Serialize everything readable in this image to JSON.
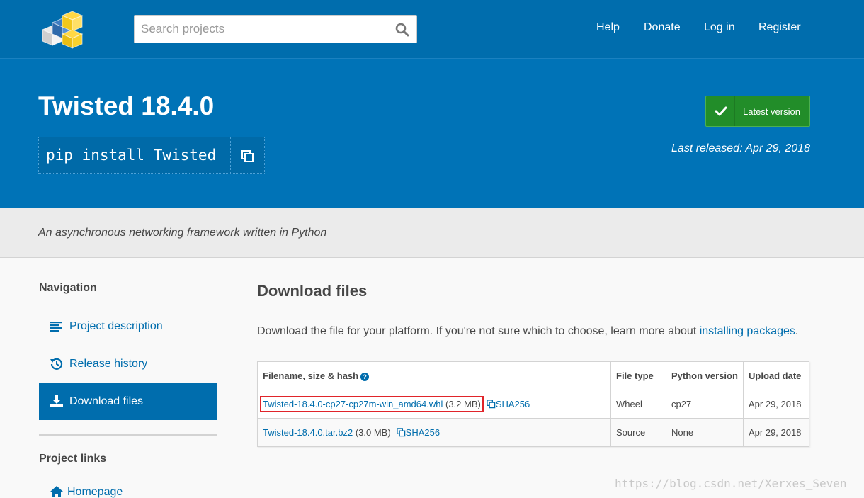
{
  "header": {
    "search_placeholder": "Search projects",
    "nav": [
      "Help",
      "Donate",
      "Log in",
      "Register"
    ]
  },
  "banner": {
    "title": "Twisted 18.4.0",
    "pip_command": "pip install Twisted",
    "latest_label": "Latest version",
    "released": "Last released: Apr 29, 2018"
  },
  "summary": "An asynchronous networking framework written in Python",
  "sidebar": {
    "navigation_heading": "Navigation",
    "items": [
      {
        "label": "Project description",
        "icon": "align-left-icon"
      },
      {
        "label": "Release history",
        "icon": "history-icon"
      },
      {
        "label": "Download files",
        "icon": "download-icon",
        "active": true
      }
    ],
    "links_heading": "Project links",
    "links": [
      {
        "label": "Homepage",
        "icon": "home-icon"
      }
    ]
  },
  "main": {
    "heading": "Download files",
    "intro_text": "Download the file for your platform. If you're not sure which to choose, learn more about ",
    "intro_link": "installing packages",
    "intro_end": ".",
    "table": {
      "headers": [
        "Filename, size & hash",
        "File type",
        "Python version",
        "Upload date"
      ],
      "rows": [
        {
          "filename": "Twisted-18.4.0-cp27-cp27m-win_amd64.whl",
          "size": "(3.2 MB)",
          "hash": "SHA256",
          "type": "Wheel",
          "python": "cp27",
          "date": "Apr 29, 2018"
        },
        {
          "filename": "Twisted-18.4.0.tar.bz2",
          "size": "(3.0 MB)",
          "hash": "SHA256",
          "type": "Source",
          "python": "None",
          "date": "Apr 29, 2018"
        }
      ]
    }
  },
  "watermark": "https://blog.csdn.net/Xerxes_Seven",
  "colors": {
    "brand": "#006dad",
    "banner": "#0073b7",
    "success": "#228d29",
    "highlight": "#e0242a"
  }
}
